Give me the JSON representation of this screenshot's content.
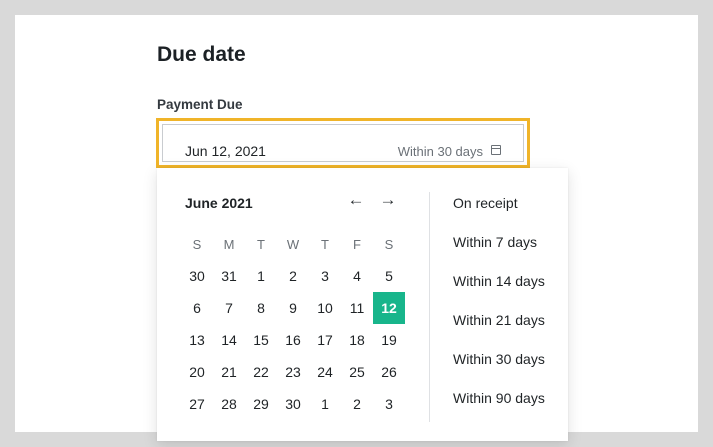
{
  "section": {
    "title": "Due date"
  },
  "field": {
    "label": "Payment Due",
    "value": "Jun 12, 2021",
    "term": "Within 30 days",
    "icon": "calendar-icon"
  },
  "calendar": {
    "month": "June 2021",
    "prev_icon": "arrow-left-icon",
    "next_icon": "arrow-right-icon",
    "weekdays": [
      "S",
      "M",
      "T",
      "W",
      "T",
      "F",
      "S"
    ],
    "weeks": [
      [
        "30",
        "31",
        "1",
        "2",
        "3",
        "4",
        "5"
      ],
      [
        "6",
        "7",
        "8",
        "9",
        "10",
        "11",
        "12"
      ],
      [
        "13",
        "14",
        "15",
        "16",
        "17",
        "18",
        "19"
      ],
      [
        "20",
        "21",
        "22",
        "23",
        "24",
        "25",
        "26"
      ],
      [
        "27",
        "28",
        "29",
        "30",
        "1",
        "2",
        "3"
      ]
    ],
    "selected_day": "12",
    "selected_color": "#18b58b"
  },
  "terms": {
    "items": [
      "On receipt",
      "Within 7 days",
      "Within 14 days",
      "Within 21 days",
      "Within 30 days",
      "Within 90 days"
    ]
  },
  "colors": {
    "focus_border": "#f0b429"
  }
}
